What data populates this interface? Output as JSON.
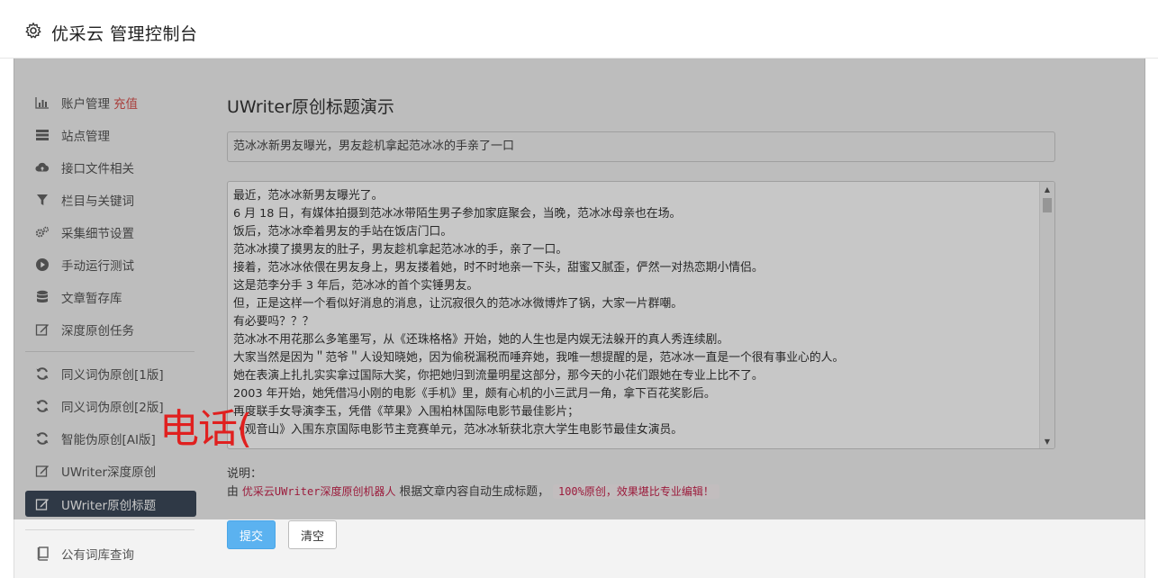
{
  "header": {
    "title": "优采云 管理控制台",
    "icon": "gear-icon"
  },
  "sidebar": {
    "items": [
      {
        "label": "账户管理",
        "extra": "充值",
        "icon": "bar-chart-icon"
      },
      {
        "label": "站点管理",
        "icon": "server-icon"
      },
      {
        "label": "接口文件相关",
        "icon": "cloud-upload-icon"
      },
      {
        "label": "栏目与关键词",
        "icon": "filter-icon"
      },
      {
        "label": "采集细节设置",
        "icon": "gears-icon"
      },
      {
        "label": "手动运行测试",
        "icon": "play-circle-icon"
      },
      {
        "label": "文章暂存库",
        "icon": "database-icon"
      },
      {
        "label": "深度原创任务",
        "icon": "edit-icon"
      }
    ],
    "group2": [
      {
        "label": "同义词伪原创[1版]",
        "icon": "refresh-icon"
      },
      {
        "label": "同义词伪原创[2版]",
        "icon": "refresh-icon"
      },
      {
        "label": "智能伪原创[AI版]",
        "icon": "refresh-icon"
      },
      {
        "label": "UWriter深度原创",
        "icon": "edit-icon"
      },
      {
        "label": "UWriter原创标题",
        "icon": "edit-icon",
        "active": true
      }
    ],
    "bottom": {
      "label": "公有词库查询",
      "icon": "book-icon"
    }
  },
  "main": {
    "title": "UWriter原创标题演示",
    "title_value": "范冰冰新男友曝光，男友趁机拿起范冰冰的手亲了一口",
    "content_lines": [
      "最近，范冰冰新男友曝光了。",
      "6 月 18 日，有媒体拍摄到范冰冰带陌生男子参加家庭聚会，当晚，范冰冰母亲也在场。",
      "饭后，范冰冰牵着男友的手站在饭店门口。",
      "范冰冰摸了摸男友的肚子，男友趁机拿起范冰冰的手，亲了一口。",
      "接着，范冰冰依偎在男友身上，男友搂着她，时不时地亲一下头，甜蜜又腻歪，俨然一对热恋期小情侣。",
      "这是范李分手 3 年后，范冰冰的首个实锤男友。",
      "但，正是这样一个看似好消息的消息，让沉寂很久的范冰冰微博炸了锅，大家一片群嘲。",
      "有必要吗？？？",
      "范冰冰不用花那么多笔墨写，从《还珠格格》开始，她的人生也是内娱无法躲开的真人秀连续剧。",
      "大家当然是因为＂范爷＂人设知晓她，因为偷税漏税而唾弃她，我唯一想提醒的是，范冰冰一直是一个很有事业心的人。",
      "她在表演上扎扎实实拿过国际大奖，你把她归到流量明星这部分，那今天的小花们跟她在专业上比不了。",
      "2003 年开始，她凭借冯小刚的电影《手机》里，颇有心机的小三武月一角，拿下百花奖影后。",
      "再度联手女导演李玉，凭借《苹果》入围柏林国际电影节最佳影片；",
      "《观音山》入围东京国际电影节主竞赛单元，范冰冰斩获北京大学生电影节最佳女演员。"
    ],
    "note_label": "说明：",
    "note_prefix": "由",
    "note_link": "优采云UWriter深度原创机器人",
    "note_middle": "根据文章内容自动生成标题，",
    "note_tag": "100%原创，效果堪比专业编辑！",
    "submit_label": "提交",
    "clear_label": "清空"
  },
  "watermark": "电话(",
  "colors": {
    "active_bg": "#3d4a5a",
    "submit_bg": "#5bb2f0",
    "accent_red": "#d9534f",
    "code_red": "#c7254e",
    "watermark_red": "#e0201f"
  }
}
